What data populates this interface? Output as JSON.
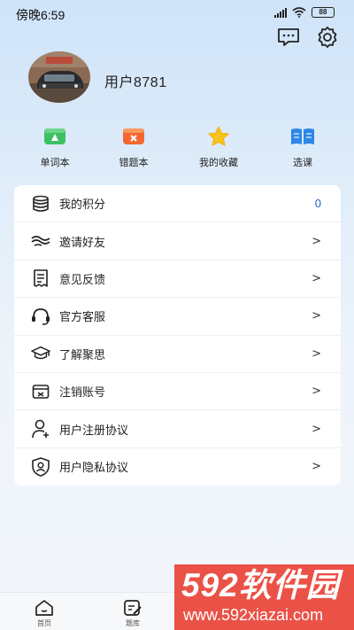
{
  "status_bar": {
    "time": "傍晚6:59",
    "battery": "88"
  },
  "profile": {
    "username": "用户8781"
  },
  "quick_actions": [
    {
      "label": "单词本",
      "icon": "vocabulary-book-icon",
      "color": "#3fbf63"
    },
    {
      "label": "错题本",
      "icon": "mistakes-book-icon",
      "color": "#f2682f"
    },
    {
      "label": "我的收藏",
      "icon": "star-icon",
      "color": "#f7c21a"
    },
    {
      "label": "选课",
      "icon": "open-book-icon",
      "color": "#2f86e6"
    }
  ],
  "menu": {
    "items": [
      {
        "label": "我的积分",
        "value": "0",
        "icon": "coins-stack-icon"
      },
      {
        "label": "邀请好友",
        "value": ">",
        "icon": "handshake-icon"
      },
      {
        "label": "意见反馈",
        "value": ">",
        "icon": "feedback-document-icon"
      },
      {
        "label": "官方客服",
        "value": ">",
        "icon": "headset-icon"
      },
      {
        "label": "了解聚思",
        "value": ">",
        "icon": "graduation-cap-icon"
      },
      {
        "label": "注销账号",
        "value": ">",
        "icon": "id-card-icon"
      },
      {
        "label": "用户注册协议",
        "value": ">",
        "icon": "user-add-icon"
      },
      {
        "label": "用户隐私协议",
        "value": ">",
        "icon": "privacy-shield-icon"
      }
    ]
  },
  "bottom_nav": [
    {
      "label": "首页",
      "icon": "home-icon"
    },
    {
      "label": "题库",
      "icon": "question-bank-icon"
    },
    {
      "label": "",
      "icon": "video-play-icon"
    },
    {
      "label": "",
      "icon": "profile-icon"
    }
  ],
  "watermark": {
    "brand": "592软件园",
    "url": "www.592xiazai.com"
  },
  "colors": {
    "accent": "#1e63c9",
    "watermark_bg": "#eb5247"
  }
}
